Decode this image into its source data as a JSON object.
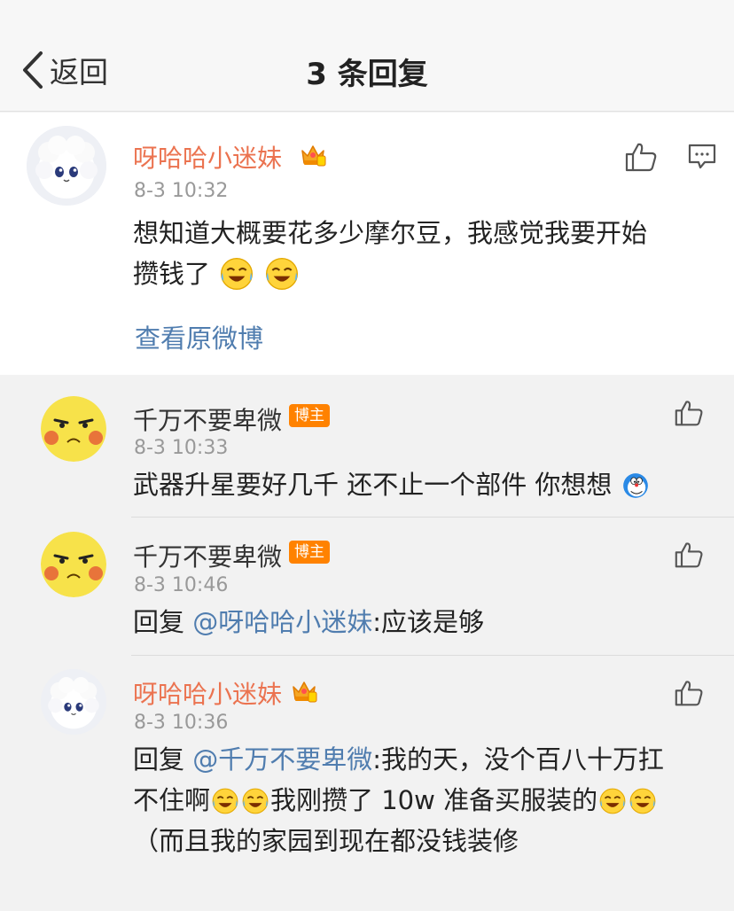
{
  "nav": {
    "back_label": "返回",
    "title": "3 条回复"
  },
  "main_comment": {
    "username": "呀哈哈小迷妹",
    "time": "8-3 10:32",
    "text_line1": "想知道大概要花多少摩尔豆，我感觉我要开始",
    "text_line2": "攒钱了",
    "view_original": "查看原微博",
    "username_color": "#eb7350"
  },
  "replies": [
    {
      "username": "千万不要卑微",
      "badge": "博主",
      "time": "8-3 10:33",
      "text": "武器升星要好几千  还不止一个部件  你想想"
    },
    {
      "username": "千万不要卑微",
      "badge": "博主",
      "time": "8-3 10:46",
      "reply_prefix": "回复 ",
      "mention": "@呀哈哈小迷妹",
      "text": ":应该是够"
    },
    {
      "username": "呀哈哈小迷妹",
      "time": "8-3 10:36",
      "reply_prefix": "回复 ",
      "mention": "@千万不要卑微",
      "text_line1": ":我的天，没个百八十万扛",
      "text_line2a": "不住啊",
      "text_line2b": "我刚攒了 10w 准备买服装的",
      "text_line3": "（而且我的家园到现在都没钱装修"
    }
  ],
  "colors": {
    "accent_orange": "#eb7350",
    "link_blue": "#507daf",
    "badge_orange": "#ff8200"
  }
}
